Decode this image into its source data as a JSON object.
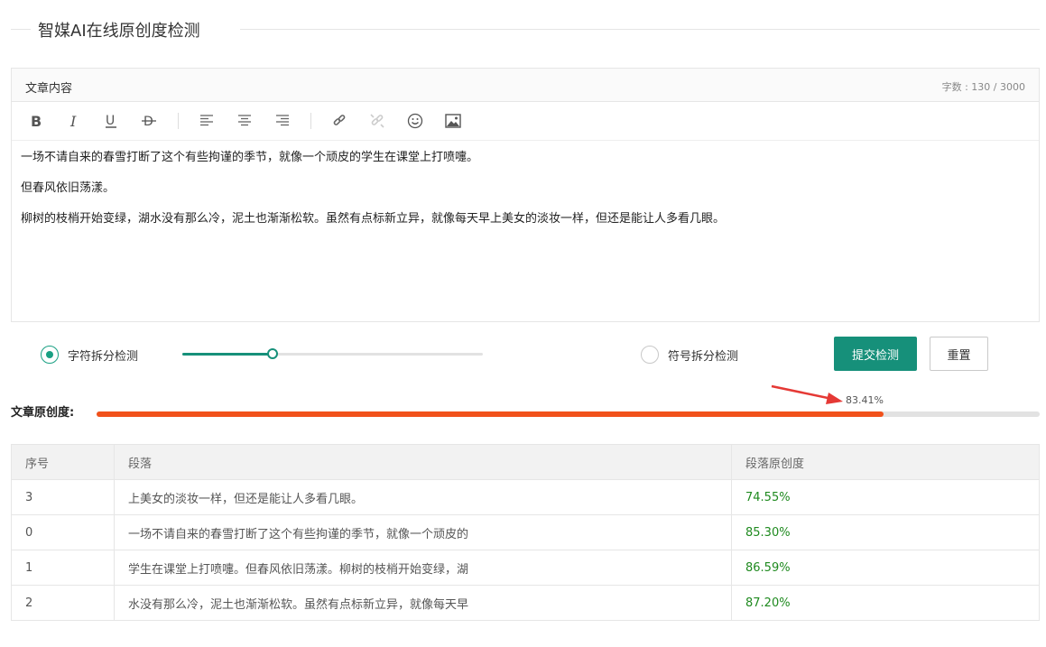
{
  "page_title": "智媒AI在线原创度检测",
  "editor": {
    "label": "文章内容",
    "count": "字数 : 130 / 3000",
    "toolbar": [
      "bold-icon",
      "italic-icon",
      "underline-icon",
      "strikethrough-icon",
      "align-left-icon",
      "align-center-icon",
      "align-right-icon",
      "link-icon",
      "unlink-icon",
      "emoji-icon",
      "image-icon"
    ],
    "paragraphs": [
      "一场不请自来的春雪打断了这个有些拘谨的季节，就像一个顽皮的学生在课堂上打喷嚏。",
      "但春风依旧荡漾。",
      "柳树的枝梢开始变绿，湖水没有那么冷，泥土也渐渐松软。虽然有点标新立异，就像每天早上美女的淡妆一样，但还是能让人多看几眼。"
    ]
  },
  "options": {
    "char_split": {
      "label": "字符拆分检测",
      "selected": true
    },
    "symbol_split": {
      "label": "符号拆分检测",
      "selected": false
    },
    "slider_value": 0.3,
    "submit_label": "提交检测",
    "reset_label": "重置"
  },
  "originality": {
    "label": "文章原创度:",
    "value_text": "83.41%",
    "value": 0.8341
  },
  "table": {
    "headers": [
      "序号",
      "段落",
      "段落原创度"
    ],
    "rows": [
      [
        "3",
        "上美女的淡妆一样，但还是能让人多看几眼。",
        "74.55%"
      ],
      [
        "0",
        "一场不请自来的春雪打断了这个有些拘谨的季节，就像一个顽皮的",
        "85.30%"
      ],
      [
        "1",
        "学生在课堂上打喷嚏。但春风依旧荡漾。柳树的枝梢开始变绿，湖",
        "86.59%"
      ],
      [
        "2",
        "水没有那么冷，泥土也渐渐松软。虽然有点标新立异，就像每天早",
        "87.20%"
      ]
    ]
  },
  "colors": {
    "accent": "#16907a",
    "progress": "#f1511b",
    "percent_text": "#1f8a1f"
  }
}
